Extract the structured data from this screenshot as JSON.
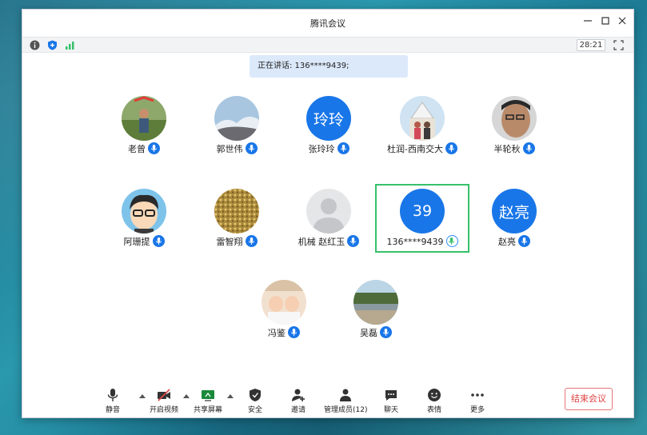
{
  "window": {
    "title": "腾讯会议"
  },
  "statusbar": {
    "timer": "28:21"
  },
  "speaking": {
    "text": "正在讲话: 136****9439;"
  },
  "participants": [
    {
      "name": "老曾",
      "avatar_type": "photo",
      "avatar_text": ""
    },
    {
      "name": "郭世伟",
      "avatar_type": "photo",
      "avatar_text": ""
    },
    {
      "name": "张玲玲",
      "avatar_type": "text",
      "avatar_text": "玲玲"
    },
    {
      "name": "杜润-西南交大",
      "avatar_type": "photo",
      "avatar_text": ""
    },
    {
      "name": "半轮秋",
      "avatar_type": "photo",
      "avatar_text": ""
    },
    {
      "name": "阿珊提",
      "avatar_type": "photo",
      "avatar_text": ""
    },
    {
      "name": "雷智翔",
      "avatar_type": "photo",
      "avatar_text": ""
    },
    {
      "name": "机械 赵红玉",
      "avatar_type": "default",
      "avatar_text": ""
    },
    {
      "name": "136****9439",
      "avatar_type": "text",
      "avatar_text": "39",
      "speaking": true
    },
    {
      "name": "赵亮",
      "avatar_type": "text",
      "avatar_text": "赵亮"
    },
    {
      "name": "冯鉴",
      "avatar_type": "photo",
      "avatar_text": ""
    },
    {
      "name": "吴磊",
      "avatar_type": "photo",
      "avatar_text": ""
    }
  ],
  "toolbar": {
    "mute": "静音",
    "video": "开启视频",
    "share": "共享屏幕",
    "security": "安全",
    "invite": "邀请",
    "manage": "管理成员(12)",
    "chat": "聊天",
    "emoji": "表情",
    "more": "更多",
    "end": "结束会议"
  },
  "colors": {
    "accent": "#1976e8",
    "active_border": "#36c06a",
    "end": "#e04545"
  }
}
